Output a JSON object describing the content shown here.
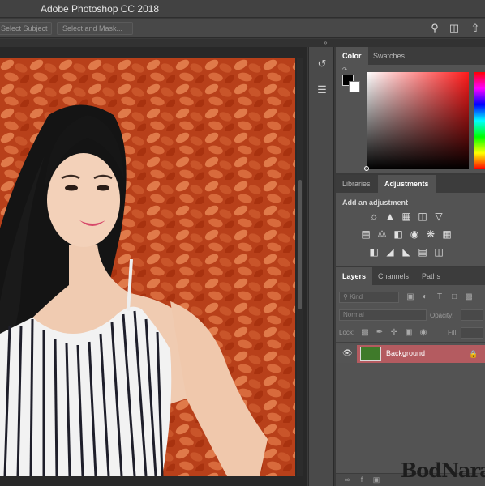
{
  "window": {
    "title": "Adobe Photoshop CC 2018"
  },
  "options_bar": {
    "select_subject": "Select Subject",
    "select_and_mask": "Select and Mask...",
    "search_icon": "search-icon",
    "workspace_icon": "workspace-icon",
    "share_icon": "share-icon"
  },
  "colors": {
    "canvas_bg": "#b53a10",
    "layer_selected": "#b45b60",
    "panel_bg": "#535353"
  },
  "color_panel": {
    "tabs": [
      {
        "label": "Color"
      },
      {
        "label": "Swatches"
      }
    ],
    "foreground": "#000000",
    "background": "#ffffff",
    "picker_hue": "#ff1a1a"
  },
  "adjustments_panel": {
    "tabs": [
      {
        "label": "Libraries"
      },
      {
        "label": "Adjustments"
      }
    ],
    "title": "Add an adjustment",
    "icons_row1": [
      "brightness-icon",
      "levels-icon",
      "curves-icon",
      "exposure-icon",
      "vibrance-icon"
    ],
    "icons_row2": [
      "hue-saturation-icon",
      "color-balance-icon",
      "black-white-icon",
      "photo-filter-icon",
      "channel-mixer-icon",
      "color-lookup-icon"
    ],
    "icons_row3": [
      "invert-icon",
      "posterize-icon",
      "threshold-icon",
      "gradient-map-icon",
      "selective-color-icon"
    ]
  },
  "layers_panel": {
    "tabs": [
      {
        "label": "Layers"
      },
      {
        "label": "Channels"
      },
      {
        "label": "Paths"
      }
    ],
    "kind_filter": "Kind",
    "blend_mode": "Normal",
    "opacity_label": "Opacity:",
    "lock_label": "Lock:",
    "fill_label": "Fill:",
    "layers": [
      {
        "name": "Background",
        "visible": true,
        "locked": true
      }
    ]
  },
  "watermark": "BodNara"
}
